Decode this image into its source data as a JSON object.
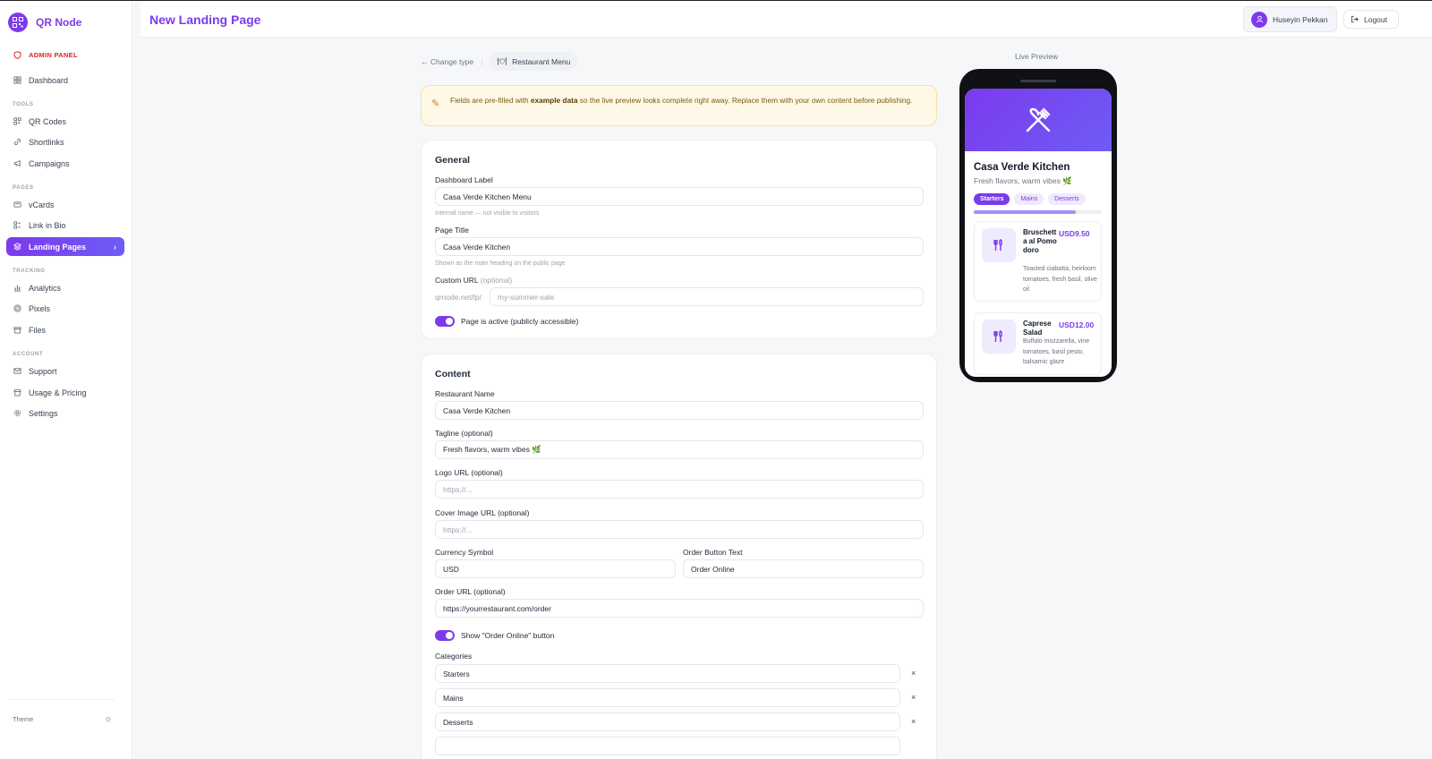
{
  "brand": {
    "name": "QR Node",
    "logo_icon": "qr-code-icon",
    "accent": "#7c3aed"
  },
  "sidebar": {
    "admin_label": "ADMIN PANEL",
    "dashboard": "Dashboard",
    "sections": {
      "tools": "TOOLS",
      "pages": "PAGES",
      "tracking": "TRACKING",
      "account": "ACCOUNT"
    },
    "tools": [
      "QR Codes",
      "Shortlinks",
      "Campaigns"
    ],
    "pages": [
      "vCards",
      "Link in Bio",
      "Landing Pages"
    ],
    "tracking": [
      "Analytics",
      "Pixels",
      "Files"
    ],
    "account": [
      "Support",
      "Usage & Pricing",
      "Settings"
    ],
    "active_item": "Landing Pages",
    "theme_label": "Theme"
  },
  "header": {
    "title": "New Landing Page",
    "user_name": "Huseyin Pekkan",
    "logout_label": "Logout"
  },
  "breadcrumb": {
    "change_type": "Change type",
    "type_name": "Restaurant Menu"
  },
  "notice": {
    "before": "Fields are pre-filled with ",
    "bold": "example data",
    "after": " so the live preview looks complete right away. Replace them with your own content before publishing."
  },
  "general": {
    "title": "General",
    "dashboard_label": {
      "label": "Dashboard Label",
      "value": "Casa Verde Kitchen Menu",
      "hint": "Internal name — not visible to visitors"
    },
    "page_title": {
      "label": "Page Title",
      "value": "Casa Verde Kitchen",
      "hint": "Shown as the main heading on the public page"
    },
    "custom_url": {
      "label": "Custom URL",
      "optional": "(optional)",
      "prefix": "qrnode.net/lp/",
      "placeholder": "my-summer-sale"
    },
    "active_toggle": {
      "label": "Page is active (publicly accessible)",
      "on": true
    }
  },
  "content": {
    "title": "Content",
    "restaurant_name": {
      "label": "Restaurant Name",
      "value": "Casa Verde Kitchen"
    },
    "tagline": {
      "label": "Tagline (optional)",
      "value": "Fresh flavors, warm vibes 🌿"
    },
    "logo_url": {
      "label": "Logo URL (optional)",
      "placeholder": "https://..."
    },
    "cover_url": {
      "label": "Cover Image URL (optional)",
      "placeholder": "https://..."
    },
    "currency": {
      "label": "Currency Symbol",
      "value": "USD"
    },
    "order_button_text": {
      "label": "Order Button Text",
      "value": "Order Online"
    },
    "order_url": {
      "label": "Order URL (optional)",
      "value": "https://yourrestaurant.com/order"
    },
    "show_order_toggle": {
      "label": "Show \"Order Online\" button",
      "on": true
    },
    "categories_label": "Categories",
    "categories": [
      "Starters",
      "Mains",
      "Desserts"
    ],
    "remove_symbol": "×"
  },
  "preview": {
    "label": "Live Preview",
    "name": "Casa Verde Kitchen",
    "tagline": "Fresh flavors, warm vibes 🌿",
    "tabs": [
      "Starters",
      "Mains",
      "Desserts"
    ],
    "active_tab": "Starters",
    "tab_scroll_fraction": 0.8,
    "items": [
      {
        "name": "Bruschetta al Pomodoro",
        "price": "USD9.50",
        "desc": "Toasted ciabatta, heirloom tomatoes, fresh basil, olive oil"
      },
      {
        "name": "Caprese Salad",
        "price": "USD12.00",
        "desc": "Buffalo mozzarella, vine tomatoes, basil pesto, balsamic glaze"
      }
    ]
  }
}
